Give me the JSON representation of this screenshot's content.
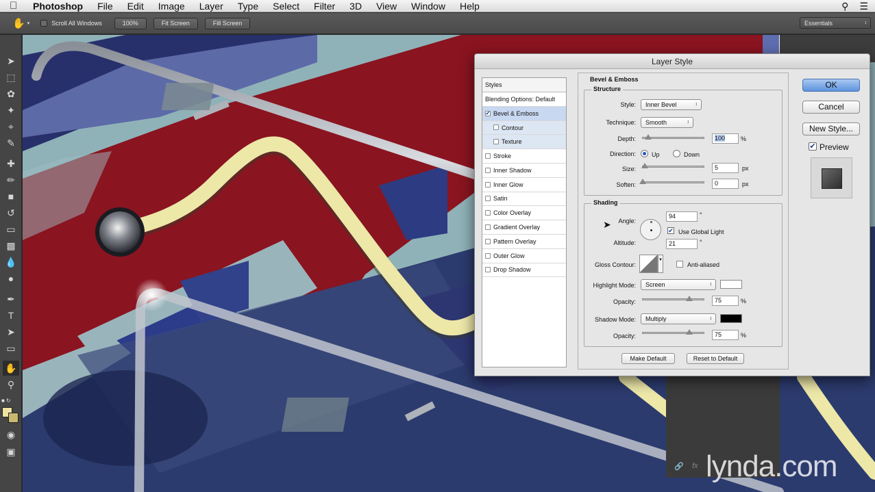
{
  "menubar": {
    "app": "Photoshop",
    "items": [
      "File",
      "Edit",
      "Image",
      "Layer",
      "Type",
      "Select",
      "Filter",
      "3D",
      "View",
      "Window",
      "Help"
    ]
  },
  "options": {
    "scroll_all": "Scroll All Windows",
    "zoom": "100%",
    "fit": "Fit Screen",
    "fill": "Fill Screen",
    "workspace": "Essentials"
  },
  "dialog": {
    "title": "Layer Style",
    "styles_header": "Styles",
    "styles": [
      {
        "label": "Blending Options: Default",
        "checkbox": false,
        "checked": false
      },
      {
        "label": "Bevel & Emboss",
        "checkbox": true,
        "checked": true
      },
      {
        "label": "Contour",
        "checkbox": true,
        "checked": false
      },
      {
        "label": "Texture",
        "checkbox": true,
        "checked": false
      },
      {
        "label": "Stroke",
        "checkbox": true,
        "checked": false
      },
      {
        "label": "Inner Shadow",
        "checkbox": true,
        "checked": false
      },
      {
        "label": "Inner Glow",
        "checkbox": true,
        "checked": false
      },
      {
        "label": "Satin",
        "checkbox": true,
        "checked": false
      },
      {
        "label": "Color Overlay",
        "checkbox": true,
        "checked": false
      },
      {
        "label": "Gradient Overlay",
        "checkbox": true,
        "checked": false
      },
      {
        "label": "Pattern Overlay",
        "checkbox": true,
        "checked": false
      },
      {
        "label": "Outer Glow",
        "checkbox": true,
        "checked": false
      },
      {
        "label": "Drop Shadow",
        "checkbox": true,
        "checked": false
      }
    ],
    "section_title": "Bevel & Emboss",
    "structure": {
      "title": "Structure",
      "style_label": "Style:",
      "style_value": "Inner Bevel",
      "technique_label": "Technique:",
      "technique_value": "Smooth",
      "depth_label": "Depth:",
      "depth_value": "100",
      "depth_unit": "%",
      "direction_label": "Direction:",
      "dir_up": "Up",
      "dir_down": "Down",
      "size_label": "Size:",
      "size_value": "5",
      "size_unit": "px",
      "soften_label": "Soften:",
      "soften_value": "0",
      "soften_unit": "px"
    },
    "shading": {
      "title": "Shading",
      "angle_label": "Angle:",
      "angle_value": "94",
      "degree": "°",
      "global_light": "Use Global Light",
      "altitude_label": "Altitude:",
      "altitude_value": "21",
      "gloss_label": "Gloss Contour:",
      "anti_aliased": "Anti-aliased",
      "highlight_label": "Highlight Mode:",
      "highlight_value": "Screen",
      "highlight_color": "#ffffff",
      "opacity_label": "Opacity:",
      "hl_opacity": "75",
      "pct": "%",
      "shadow_label": "Shadow Mode:",
      "shadow_value": "Multiply",
      "shadow_color": "#000000",
      "sh_opacity": "75"
    },
    "make_default": "Make Default",
    "reset_default": "Reset to Default",
    "ok": "OK",
    "cancel": "Cancel",
    "new_style": "New Style...",
    "preview": "Preview"
  },
  "watermark": "lynda.com"
}
